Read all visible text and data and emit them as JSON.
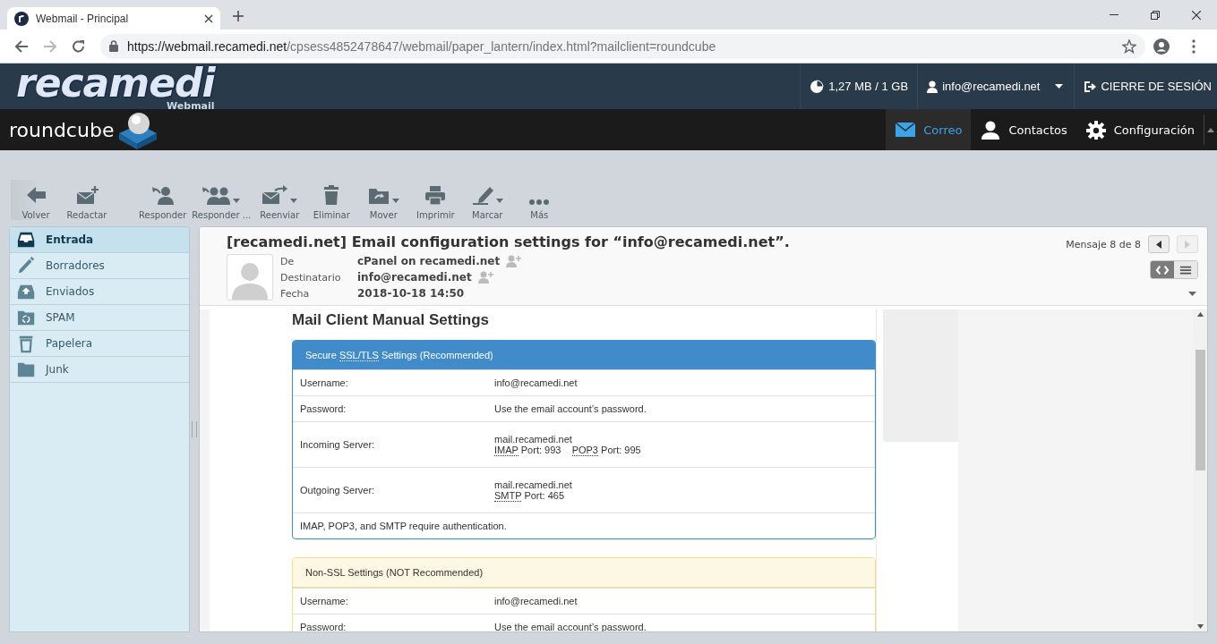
{
  "browser": {
    "tab_title": "Webmail - Principal",
    "url_host": "https://webmail.recamedi.net",
    "url_path": "/cpsess4852478647/webmail/paper_lantern/index.html?mailclient=roundcube"
  },
  "cpanel": {
    "logo": "recamedi",
    "logo_sub": "Webmail",
    "quota": "1,27 MB / 1 GB",
    "user": "info@recamedi.net",
    "logout": "CIERRE DE SESIÓN"
  },
  "app": {
    "logo": "roundcube",
    "nav": [
      {
        "label": "Correo",
        "selected": true
      },
      {
        "label": "Contactos",
        "selected": false
      },
      {
        "label": "Configuración",
        "selected": false
      }
    ]
  },
  "toolbar": [
    {
      "label": "Volver",
      "dropdown": false
    },
    {
      "label": "Redactar",
      "dropdown": false
    },
    {
      "label": "Responder",
      "dropdown": false
    },
    {
      "label": "Responder ...",
      "dropdown": true
    },
    {
      "label": "Reenviar",
      "dropdown": true
    },
    {
      "label": "Eliminar",
      "dropdown": false
    },
    {
      "label": "Mover",
      "dropdown": true
    },
    {
      "label": "Imprimir",
      "dropdown": false
    },
    {
      "label": "Marcar",
      "dropdown": true
    },
    {
      "label": "Más",
      "dropdown": false
    }
  ],
  "folders": [
    {
      "label": "Entrada",
      "selected": true
    },
    {
      "label": "Borradores",
      "selected": false
    },
    {
      "label": "Enviados",
      "selected": false
    },
    {
      "label": "SPAM",
      "selected": false
    },
    {
      "label": "Papelera",
      "selected": false
    },
    {
      "label": "Junk",
      "selected": false
    }
  ],
  "message": {
    "subject": "[recamedi.net] Email configuration settings for “info@recamedi.net”.",
    "position": "Mensaje 8 de 8",
    "prev_disabled": false,
    "next_disabled": true,
    "view": [
      {
        "selected": true
      },
      {
        "selected": false
      }
    ],
    "headers": [
      {
        "label": "De",
        "value": "cPanel on recamedi.net",
        "add_contact": true
      },
      {
        "label": "Destinatario",
        "value": "info@recamedi.net",
        "add_contact": true
      },
      {
        "label": "Fecha",
        "value": "2018-10-18 14:50",
        "add_contact": false
      }
    ]
  },
  "body": {
    "heading": "Mail Client Manual Settings",
    "panels": [
      {
        "kind": "secure",
        "title": [
          {
            "text": "Secure ",
            "abbr": false
          },
          {
            "text": "SSL/TLS",
            "abbr": true
          },
          {
            "text": " Settings (Recommended)",
            "abbr": false
          }
        ],
        "rows": [
          {
            "label": "Username:",
            "lines": [
              [
                {
                  "text": "info@recamedi.net",
                  "abbr": false
                }
              ]
            ]
          },
          {
            "label": "Password:",
            "lines": [
              [
                {
                  "text": "Use the email account’s password.",
                  "abbr": false
                }
              ]
            ]
          },
          {
            "label": "Incoming Server:",
            "lines": [
              [
                {
                  "text": "mail.recamedi.net",
                  "abbr": false
                }
              ],
              [
                {
                  "text": "IMAP",
                  "abbr": true
                },
                {
                  "text": " Port: 993    ",
                  "abbr": false
                },
                {
                  "text": "POP3",
                  "abbr": true
                },
                {
                  "text": " Port: 995",
                  "abbr": false
                }
              ]
            ]
          },
          {
            "label": "Outgoing Server:",
            "lines": [
              [
                {
                  "text": "mail.recamedi.net",
                  "abbr": false
                }
              ],
              [
                {
                  "text": "SMTP",
                  "abbr": true
                },
                {
                  "text": " Port: 465",
                  "abbr": false
                }
              ]
            ]
          }
        ],
        "note": "IMAP, POP3, and SMTP require authentication."
      },
      {
        "kind": "insecure",
        "title": [
          {
            "text": "Non-SSL Settings (NOT Recommended)",
            "abbr": false
          }
        ],
        "rows": [
          {
            "label": "Username:",
            "lines": [
              [
                {
                  "text": "info@recamedi.net",
                  "abbr": false
                }
              ]
            ]
          },
          {
            "label": "Password:",
            "lines": [
              [
                {
                  "text": "Use the email account’s password.",
                  "abbr": false
                }
              ]
            ]
          }
        ]
      }
    ]
  }
}
